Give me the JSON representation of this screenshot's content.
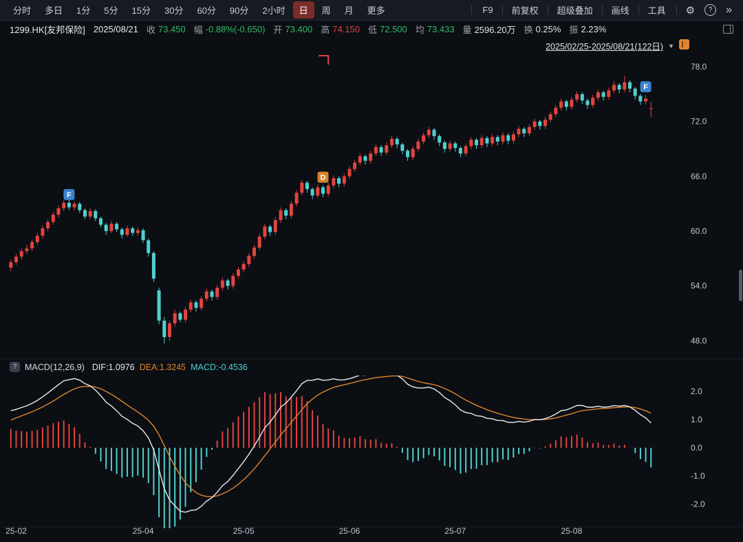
{
  "toolbar": {
    "periods": [
      "分时",
      "多日",
      "1分",
      "5分",
      "15分",
      "30分",
      "60分",
      "90分",
      "2小时",
      "日",
      "周",
      "月",
      "更多"
    ],
    "selected_period": "日",
    "tools": [
      "F9",
      "前复权",
      "超级叠加",
      "画线",
      "工具"
    ],
    "icons": [
      {
        "name": "settings",
        "glyph": "⚙"
      },
      {
        "name": "help",
        "glyph": "?"
      },
      {
        "name": "collapse",
        "glyph": "»"
      }
    ]
  },
  "infobar": {
    "symbol": "1299.HK[友邦保险]",
    "date": "2025/08/21",
    "fields": [
      {
        "label": "收",
        "value": "73.450",
        "tone": "down"
      },
      {
        "label": "幅",
        "value": "-0.88%(-0.650)",
        "tone": "down"
      },
      {
        "label": "开",
        "value": "73.400",
        "tone": "down"
      },
      {
        "label": "高",
        "value": "74.150",
        "tone": "up"
      },
      {
        "label": "低",
        "value": "72.500",
        "tone": "down"
      },
      {
        "label": "均",
        "value": "73.433",
        "tone": "down"
      },
      {
        "label": "量",
        "value": "2596.20万",
        "tone": "flat"
      },
      {
        "label": "换",
        "value": "0.25%",
        "tone": "flat"
      },
      {
        "label": "振",
        "value": "2.23%",
        "tone": "flat"
      }
    ]
  },
  "range_selector": {
    "label": "2025/02/25-2025/08/21(122日)",
    "caret": "▼"
  },
  "colors": {
    "up": "#e2443e",
    "down": "#4fd1d0",
    "text_up": "#e2443e",
    "text_down": "#2fbe69",
    "text_flat": "#dfe3e8",
    "dif_line": "#e9ecf1",
    "dea_line": "#e0862f",
    "marker_blue": "#3b82d0",
    "marker_orange": "#d8822b",
    "selected_tab_bg": "#7a2c28",
    "axis_text": "#c3c8d1",
    "annotation": "#e2443e"
  },
  "chart_data": {
    "type": "candlestick+macd",
    "symbol": "1299.HK",
    "period": "日",
    "date_range": "2025/02/25-2025/08/21",
    "bar_count": 122,
    "price_axis_ticks": [
      78.0,
      72.0,
      66.0,
      60.0,
      54.0,
      48.0
    ],
    "macd_axis_ticks": [
      "2.0",
      "1.0",
      "0.0",
      "-1.0",
      "-2.0"
    ],
    "x_axis_ticks": [
      {
        "index": 1,
        "label": "25-02"
      },
      {
        "index": 25,
        "label": "25-04"
      },
      {
        "index": 44,
        "label": "25-05"
      },
      {
        "index": 64,
        "label": "25-06"
      },
      {
        "index": 84,
        "label": "25-07"
      },
      {
        "index": 106,
        "label": "25-08"
      }
    ],
    "candles": [
      [
        56.0,
        56.9,
        55.6,
        56.6
      ],
      [
        56.6,
        57.5,
        56.3,
        57.2
      ],
      [
        57.2,
        58.1,
        56.9,
        57.8
      ],
      [
        57.8,
        58.5,
        57.5,
        58.1
      ],
      [
        58.1,
        59.1,
        57.8,
        58.8
      ],
      [
        58.8,
        59.8,
        58.5,
        59.5
      ],
      [
        59.5,
        60.6,
        59.2,
        60.3
      ],
      [
        60.3,
        61.3,
        60.0,
        61.0
      ],
      [
        61.0,
        62.1,
        60.7,
        61.8
      ],
      [
        61.8,
        62.8,
        61.5,
        62.5
      ],
      [
        62.5,
        63.4,
        62.2,
        63.1
      ],
      [
        63.1,
        63.5,
        62.3,
        62.6
      ],
      [
        62.6,
        63.3,
        62.3,
        63.0
      ],
      [
        63.0,
        63.2,
        62.0,
        62.3
      ],
      [
        62.3,
        62.5,
        61.3,
        61.6
      ],
      [
        61.6,
        62.5,
        61.3,
        62.2
      ],
      [
        62.2,
        62.4,
        61.1,
        61.4
      ],
      [
        61.4,
        61.6,
        60.4,
        60.7
      ],
      [
        60.7,
        60.9,
        59.6,
        60.0
      ],
      [
        60.0,
        61.1,
        59.8,
        60.8
      ],
      [
        60.8,
        61.0,
        59.9,
        60.2
      ],
      [
        60.2,
        60.4,
        59.2,
        59.6
      ],
      [
        59.6,
        60.6,
        59.4,
        60.3
      ],
      [
        60.3,
        60.5,
        59.5,
        59.8
      ],
      [
        59.8,
        60.4,
        59.5,
        60.1
      ],
      [
        60.1,
        60.3,
        58.7,
        59.0
      ],
      [
        59.0,
        59.2,
        57.2,
        57.6
      ],
      [
        57.6,
        57.8,
        54.4,
        54.8
      ],
      [
        53.5,
        53.8,
        49.8,
        50.2
      ],
      [
        50.2,
        50.6,
        47.7,
        48.4
      ],
      [
        48.4,
        50.2,
        48.0,
        49.9
      ],
      [
        49.9,
        51.4,
        49.5,
        51.0
      ],
      [
        51.0,
        51.2,
        50.0,
        50.3
      ],
      [
        50.3,
        51.7,
        50.0,
        51.4
      ],
      [
        51.4,
        52.5,
        51.1,
        52.2
      ],
      [
        52.2,
        52.4,
        51.2,
        51.6
      ],
      [
        51.6,
        52.9,
        51.3,
        52.6
      ],
      [
        52.6,
        53.7,
        52.3,
        53.4
      ],
      [
        53.4,
        53.6,
        52.4,
        52.8
      ],
      [
        52.8,
        54.1,
        52.5,
        53.8
      ],
      [
        53.8,
        54.9,
        53.5,
        54.6
      ],
      [
        54.6,
        54.8,
        53.6,
        54.0
      ],
      [
        54.0,
        55.4,
        53.7,
        55.1
      ],
      [
        55.1,
        56.1,
        54.8,
        55.8
      ],
      [
        55.8,
        56.7,
        55.5,
        56.4
      ],
      [
        56.4,
        57.6,
        56.1,
        57.3
      ],
      [
        57.3,
        58.5,
        57.0,
        58.2
      ],
      [
        58.2,
        59.7,
        57.9,
        59.4
      ],
      [
        59.4,
        60.8,
        59.1,
        60.5
      ],
      [
        60.5,
        60.7,
        59.5,
        59.9
      ],
      [
        59.9,
        61.5,
        59.6,
        61.2
      ],
      [
        61.2,
        62.6,
        60.9,
        62.3
      ],
      [
        62.3,
        62.5,
        61.3,
        61.7
      ],
      [
        61.7,
        63.3,
        61.4,
        63.0
      ],
      [
        63.0,
        64.5,
        62.7,
        64.2
      ],
      [
        64.2,
        65.6,
        63.9,
        65.3
      ],
      [
        65.3,
        65.5,
        64.2,
        64.6
      ],
      [
        64.6,
        64.8,
        63.5,
        63.9
      ],
      [
        63.9,
        65.1,
        63.6,
        64.8
      ],
      [
        64.8,
        65.0,
        63.7,
        64.1
      ],
      [
        64.1,
        65.3,
        63.8,
        65.0
      ],
      [
        65.0,
        66.1,
        64.7,
        65.8
      ],
      [
        65.8,
        66.0,
        64.8,
        65.2
      ],
      [
        65.2,
        66.3,
        64.9,
        66.0
      ],
      [
        66.0,
        67.1,
        65.7,
        66.8
      ],
      [
        66.8,
        67.8,
        66.5,
        67.5
      ],
      [
        67.5,
        68.5,
        67.2,
        68.2
      ],
      [
        68.2,
        68.4,
        67.3,
        67.7
      ],
      [
        67.7,
        68.8,
        67.4,
        68.5
      ],
      [
        68.5,
        69.5,
        68.2,
        69.2
      ],
      [
        69.2,
        69.4,
        68.2,
        68.6
      ],
      [
        68.6,
        69.7,
        68.3,
        69.4
      ],
      [
        69.4,
        70.4,
        69.1,
        70.1
      ],
      [
        70.1,
        70.3,
        69.1,
        69.5
      ],
      [
        69.5,
        69.7,
        68.4,
        68.8
      ],
      [
        68.8,
        69.0,
        67.7,
        68.1
      ],
      [
        68.1,
        69.3,
        67.8,
        69.0
      ],
      [
        69.0,
        70.1,
        68.7,
        69.8
      ],
      [
        69.8,
        70.8,
        69.5,
        70.5
      ],
      [
        70.5,
        71.4,
        70.2,
        71.1
      ],
      [
        71.1,
        71.3,
        70.0,
        70.4
      ],
      [
        70.4,
        70.6,
        69.3,
        69.7
      ],
      [
        69.7,
        69.9,
        68.6,
        69.0
      ],
      [
        69.0,
        69.9,
        68.7,
        69.6
      ],
      [
        69.6,
        69.8,
        68.7,
        69.1
      ],
      [
        69.1,
        69.3,
        68.1,
        68.5
      ],
      [
        68.5,
        69.6,
        68.2,
        69.3
      ],
      [
        69.3,
        70.3,
        69.0,
        70.0
      ],
      [
        70.0,
        70.2,
        69.0,
        69.4
      ],
      [
        69.4,
        70.5,
        69.1,
        70.2
      ],
      [
        70.2,
        70.4,
        69.2,
        69.6
      ],
      [
        69.6,
        70.6,
        69.3,
        70.3
      ],
      [
        70.3,
        70.5,
        69.4,
        69.8
      ],
      [
        69.8,
        70.8,
        69.5,
        70.5
      ],
      [
        70.5,
        70.7,
        69.5,
        69.9
      ],
      [
        69.9,
        70.9,
        69.6,
        70.6
      ],
      [
        70.6,
        71.5,
        70.3,
        71.2
      ],
      [
        71.2,
        71.4,
        70.3,
        70.7
      ],
      [
        70.7,
        71.7,
        70.4,
        71.4
      ],
      [
        71.4,
        72.3,
        71.1,
        72.0
      ],
      [
        72.0,
        72.2,
        71.1,
        71.5
      ],
      [
        71.5,
        72.5,
        71.2,
        72.2
      ],
      [
        72.2,
        73.1,
        71.9,
        72.8
      ],
      [
        72.8,
        73.8,
        72.5,
        73.5
      ],
      [
        73.5,
        74.5,
        73.2,
        74.2
      ],
      [
        74.2,
        74.4,
        73.2,
        73.6
      ],
      [
        73.6,
        74.7,
        73.3,
        74.4
      ],
      [
        74.4,
        75.3,
        74.1,
        75.0
      ],
      [
        75.0,
        75.2,
        73.9,
        74.3
      ],
      [
        74.3,
        74.5,
        73.4,
        73.8
      ],
      [
        73.8,
        74.9,
        73.5,
        74.6
      ],
      [
        74.6,
        75.5,
        74.3,
        75.2
      ],
      [
        75.2,
        75.4,
        74.3,
        74.7
      ],
      [
        74.7,
        75.7,
        74.4,
        75.4
      ],
      [
        75.4,
        76.4,
        75.1,
        76.0
      ],
      [
        76.0,
        76.2,
        75.1,
        75.5
      ],
      [
        75.5,
        77.0,
        75.2,
        76.3
      ],
      [
        76.3,
        76.5,
        75.2,
        75.6
      ],
      [
        75.6,
        75.8,
        74.4,
        74.8
      ],
      [
        74.8,
        75.0,
        73.8,
        74.2
      ],
      [
        74.2,
        74.9,
        73.9,
        74.5
      ],
      [
        73.4,
        74.15,
        72.5,
        73.45
      ]
    ],
    "markers": [
      {
        "label": "F",
        "index": 11,
        "price": 64.0,
        "color": "#3b82d0"
      },
      {
        "label": "D",
        "index": 59,
        "price": 65.9,
        "color": "#d8822b"
      },
      {
        "label": "F",
        "index": 120,
        "price": 75.8,
        "color": "#3b82d0"
      }
    ],
    "annotation": {
      "type": "corner-bracket",
      "index": 60,
      "price": 79.2,
      "color": "#e2443e"
    },
    "macd": {
      "name": "MACD(12,26,9)",
      "dif_label": "DIF:1.0976",
      "dea_label": "DEA:1.3245",
      "macd_label": "MACD:-0.4536",
      "help_glyph": "?",
      "params": [
        12,
        26,
        9
      ],
      "seed": {
        "ema12": 55.2,
        "ema26": 53.9,
        "dea": 0.9
      }
    }
  }
}
